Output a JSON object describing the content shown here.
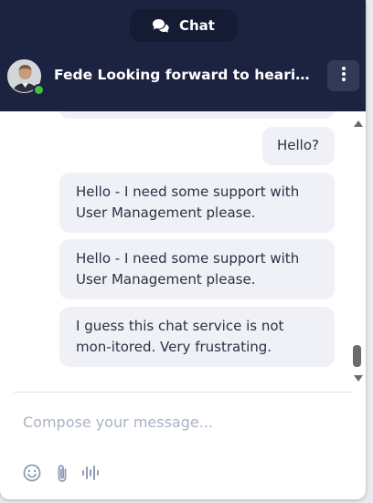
{
  "header": {
    "tab_label": "Chat",
    "agent_title": "Fede Looking forward to hearing …"
  },
  "messages": [
    {
      "from": "user",
      "text": "Hello?"
    },
    {
      "from": "user",
      "text": "Hello - I need some support with User Management please."
    },
    {
      "from": "user",
      "text": "Hello - I need some support with User Management please."
    },
    {
      "from": "user",
      "text": "I guess this chat service is not mon-itored. Very frustrating."
    }
  ],
  "composer": {
    "placeholder": "Compose your message...",
    "value": ""
  },
  "icons": {
    "tab": "chat-bubbles-icon",
    "menu": "kebab-menu-icon",
    "emoji": "emoji-icon",
    "attach": "paperclip-icon",
    "voice": "voice-wave-icon"
  },
  "colors": {
    "header_bg": "#1b2340",
    "bubble_bg": "#f0f1f6",
    "online_status": "#3fc23f",
    "placeholder": "#aab3c2"
  }
}
